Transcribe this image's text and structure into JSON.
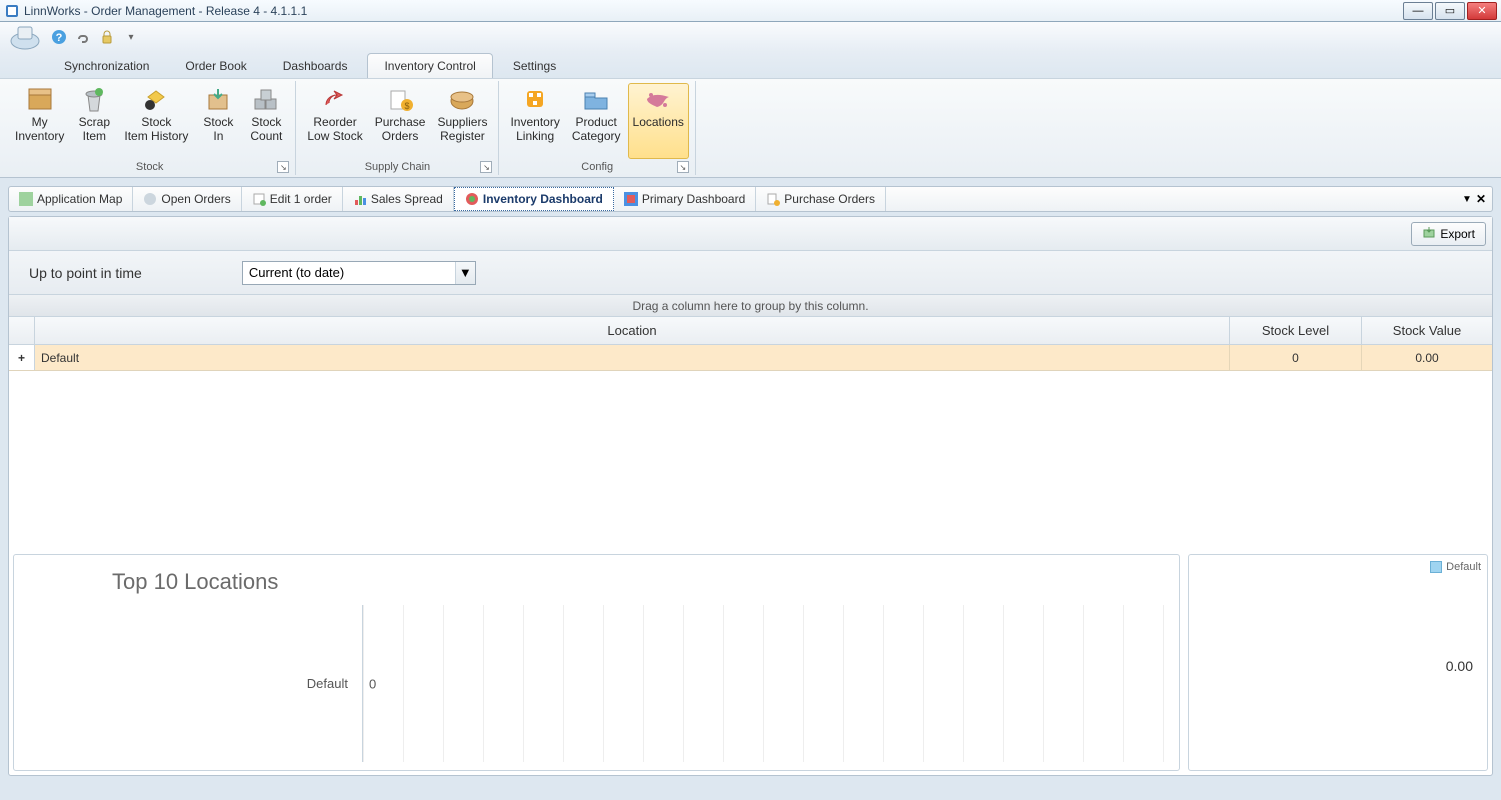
{
  "window": {
    "title": "LinnWorks - Order Management - Release 4 - 4.1.1.1"
  },
  "menu_tabs": {
    "sync": "Synchronization",
    "orderbook": "Order Book",
    "dashboards": "Dashboards",
    "inventory": "Inventory Control",
    "settings": "Settings"
  },
  "ribbon": {
    "groups": {
      "stock": "Stock",
      "supply_chain": "Supply Chain",
      "config": "Config"
    },
    "items": {
      "my_inventory": "My\nInventory",
      "scrap_item": "Scrap\nItem",
      "stock_item_history": "Stock\nItem History",
      "stock_in": "Stock\nIn",
      "stock_count": "Stock\nCount",
      "reorder_low_stock": "Reorder\nLow Stock",
      "purchase_orders": "Purchase\nOrders",
      "suppliers_register": "Suppliers\nRegister",
      "inventory_linking": "Inventory\nLinking",
      "product_category": "Product\nCategory",
      "locations": "Locations"
    }
  },
  "doc_tabs": {
    "app_map": "Application Map",
    "open_orders": "Open Orders",
    "edit_order": "Edit 1 order",
    "sales_spread": "Sales Spread",
    "inventory_dashboard": "Inventory Dashboard",
    "primary_dashboard": "Primary Dashboard",
    "purchase_orders": "Purchase Orders"
  },
  "toolbar": {
    "export": "Export"
  },
  "filter": {
    "label": "Up to point in time",
    "selected": "Current (to date)"
  },
  "grid": {
    "group_by_hint": "Drag a column here to group by this column.",
    "col_location": "Location",
    "col_stock_level": "Stock Level",
    "col_stock_value": "Stock Value",
    "row1": {
      "expand": "+",
      "location": "Default",
      "stock_level": "0",
      "stock_value": "0.00"
    }
  },
  "chart_left": {
    "title": "Top 10 Locations",
    "bar_label": "Default",
    "bar_value": "0"
  },
  "chart_right": {
    "legend": "Default",
    "value": "0.00"
  },
  "chart_data": [
    {
      "type": "bar",
      "title": "Top 10 Locations",
      "orientation": "horizontal",
      "categories": [
        "Default"
      ],
      "values": [
        0
      ],
      "xlabel": "",
      "ylabel": ""
    },
    {
      "type": "pie",
      "series": [
        {
          "name": "Default",
          "value": 0.0
        }
      ],
      "total_label": "0.00"
    }
  ]
}
